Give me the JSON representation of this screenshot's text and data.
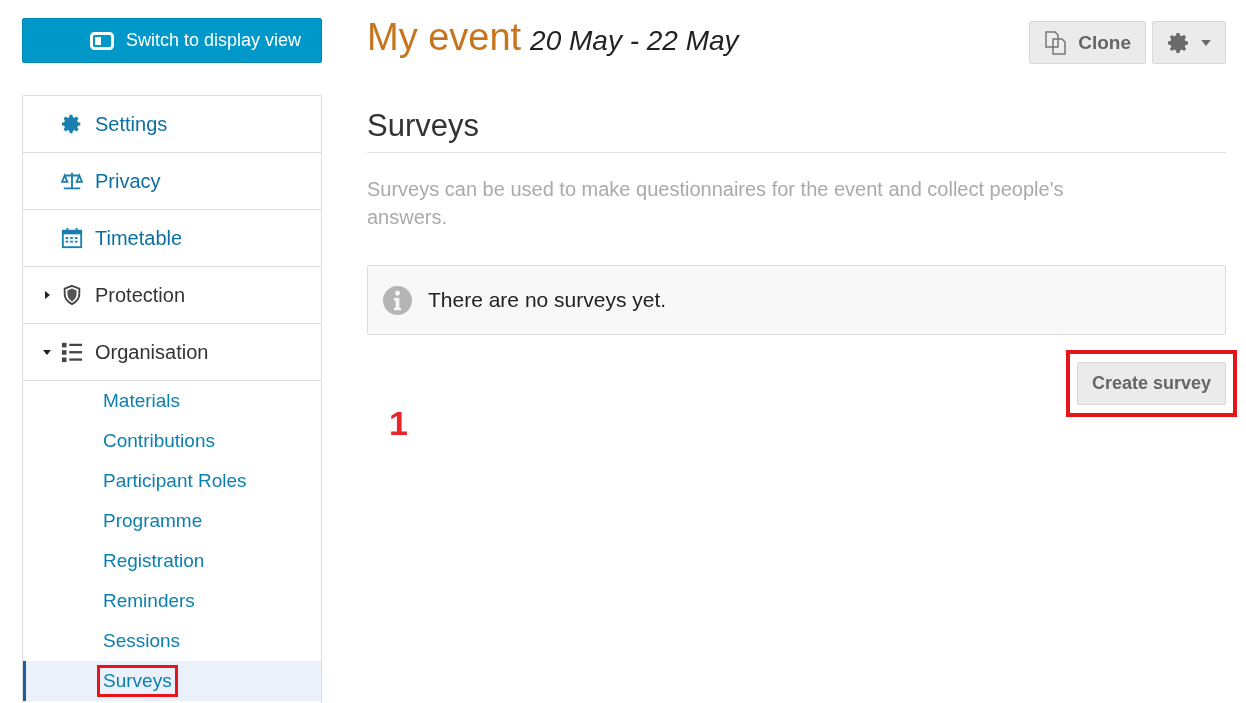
{
  "display_button": {
    "label": "Switch to display view"
  },
  "event": {
    "title": "My event",
    "dates": "20 May - 22 May"
  },
  "actions": {
    "clone": "Clone"
  },
  "menu": [
    {
      "label": "Settings",
      "expandable": false
    },
    {
      "label": "Privacy",
      "expandable": false
    },
    {
      "label": "Timetable",
      "expandable": false
    },
    {
      "label": "Protection",
      "expandable": true,
      "expanded": false
    },
    {
      "label": "Organisation",
      "expandable": true,
      "expanded": true,
      "children": [
        {
          "label": "Materials",
          "selected": false,
          "highlighted": false
        },
        {
          "label": "Contributions",
          "selected": false,
          "highlighted": false
        },
        {
          "label": "Participant Roles",
          "selected": false,
          "highlighted": false
        },
        {
          "label": "Programme",
          "selected": false,
          "highlighted": false
        },
        {
          "label": "Registration",
          "selected": false,
          "highlighted": false
        },
        {
          "label": "Reminders",
          "selected": false,
          "highlighted": false
        },
        {
          "label": "Sessions",
          "selected": false,
          "highlighted": false
        },
        {
          "label": "Surveys",
          "selected": true,
          "highlighted": true
        }
      ]
    }
  ],
  "section": {
    "title": "Surveys",
    "description": "Surveys can be used to make questionnaires for the event and collect people's answers.",
    "notice": "There are no surveys yet.",
    "create_button": {
      "label": "Create survey",
      "highlighted": true
    }
  },
  "step_marker": "1"
}
